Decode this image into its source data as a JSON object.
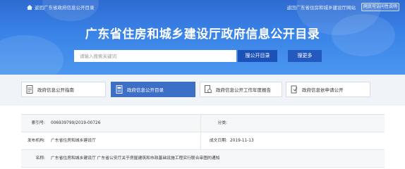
{
  "topbar": {
    "home_link": "返回广东省政府信息公开目录",
    "site_link": "返回广东省住房和城乡建设厅网站",
    "button": "网页可访问性说明"
  },
  "header": {
    "title": "广东省住房和城乡建设厅政府信息公开目录"
  },
  "search": {
    "placeholder": "请输入搜索关键词",
    "search_button": "搜公开目录",
    "more_button": "搜更多"
  },
  "tabs": [
    {
      "label": "政府信息公开指南",
      "icon": "document-icon",
      "active": false
    },
    {
      "label": "政府信息公开目录",
      "icon": "list-icon",
      "active": true
    },
    {
      "label": "政府信息公开工作年度报告",
      "icon": "report-icon",
      "active": false
    },
    {
      "label": "政府信息依申请公开",
      "icon": "request-icon",
      "active": false
    }
  ],
  "info": {
    "index_label": "索引号:",
    "index_value": "006939799/2019-00726",
    "category_label": "分类:",
    "category_value": "",
    "publisher_label": "发布机构:",
    "publisher_value": "广东省住房和城乡建设厅",
    "date_label": "成文日期:",
    "date_value": "2019-11-13",
    "title_label": "名称:",
    "title_value": "广东省住房和城乡建设厅 广东省公安厅关于房屋建筑和市政基础设施工程实行联合审图的通知"
  },
  "colors": {
    "banner": "#3a83e8",
    "button": "#1c52b8",
    "active_tab": "#3e6fc7"
  }
}
